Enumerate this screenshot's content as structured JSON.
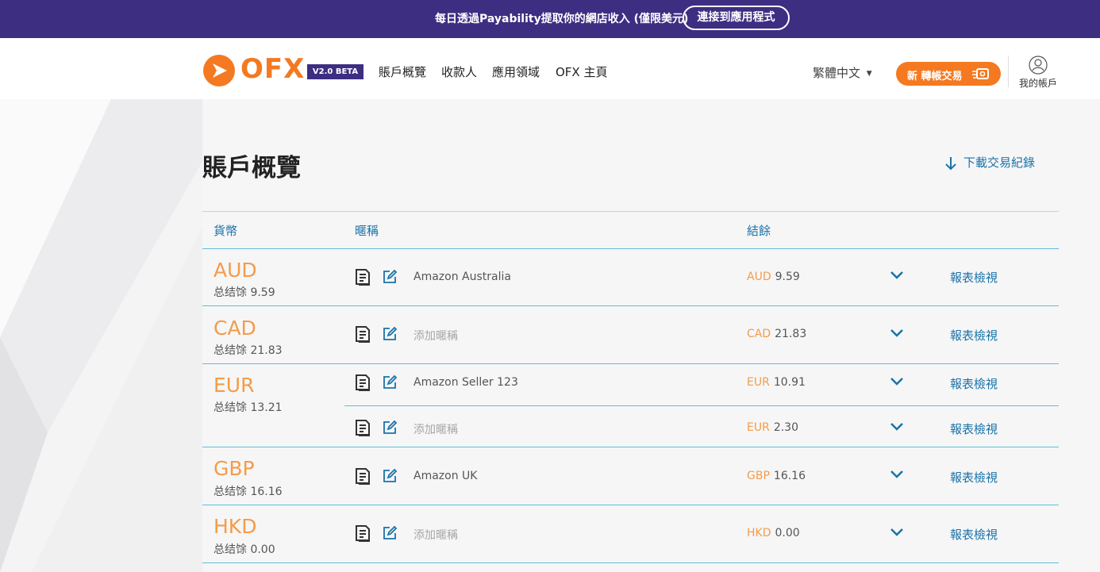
{
  "banner": {
    "text": "每日透過Payability提取你的網店收入 (僅限美元)",
    "button": "連接到應用程式"
  },
  "header": {
    "logo": "OFX",
    "beta": "V2.0 BETA",
    "nav": [
      "賬戶概覽",
      "收款人",
      "應用領域",
      "OFX 主頁"
    ],
    "language": "繁體中文",
    "new_transfer": "新 轉帳交易",
    "account": "我的帳戶"
  },
  "page": {
    "title": "賬戶概覽",
    "download": "下載交易紀錄"
  },
  "table": {
    "headers": {
      "currency": "貨幣",
      "nickname": "暱稱",
      "balance": "結餘"
    },
    "groups": [
      {
        "currency": "AUD",
        "total": "总结馀 9.59",
        "rows": [
          {
            "nickname": "Amazon Australia",
            "placeholder": false,
            "code": "AUD",
            "amount": "9.59",
            "action": "報表檢視"
          }
        ]
      },
      {
        "currency": "CAD",
        "total": "总结馀 21.83",
        "rows": [
          {
            "nickname": "添加暱稱",
            "placeholder": true,
            "code": "CAD",
            "amount": "21.83",
            "action": "報表檢視"
          }
        ]
      },
      {
        "currency": "EUR",
        "total": "总结馀 13.21",
        "rows": [
          {
            "nickname": "Amazon Seller 123",
            "placeholder": false,
            "code": "EUR",
            "amount": "10.91",
            "action": "報表檢視"
          },
          {
            "nickname": "添加暱稱",
            "placeholder": true,
            "code": "EUR",
            "amount": "2.30",
            "action": "報表檢視"
          }
        ]
      },
      {
        "currency": "GBP",
        "total": "总结馀 16.16",
        "rows": [
          {
            "nickname": "Amazon UK",
            "placeholder": false,
            "code": "GBP",
            "amount": "16.16",
            "action": "報表檢視"
          }
        ]
      },
      {
        "currency": "HKD",
        "total": "总结馀 0.00",
        "rows": [
          {
            "nickname": "添加暱稱",
            "placeholder": true,
            "code": "HKD",
            "amount": "0.00",
            "action": "報表檢視"
          }
        ]
      }
    ]
  },
  "colors": {
    "banner": "#3d2e82",
    "accent_orange": "#f47920",
    "link_blue": "#1a73a8",
    "divider_teal": "#5bc0d6"
  }
}
